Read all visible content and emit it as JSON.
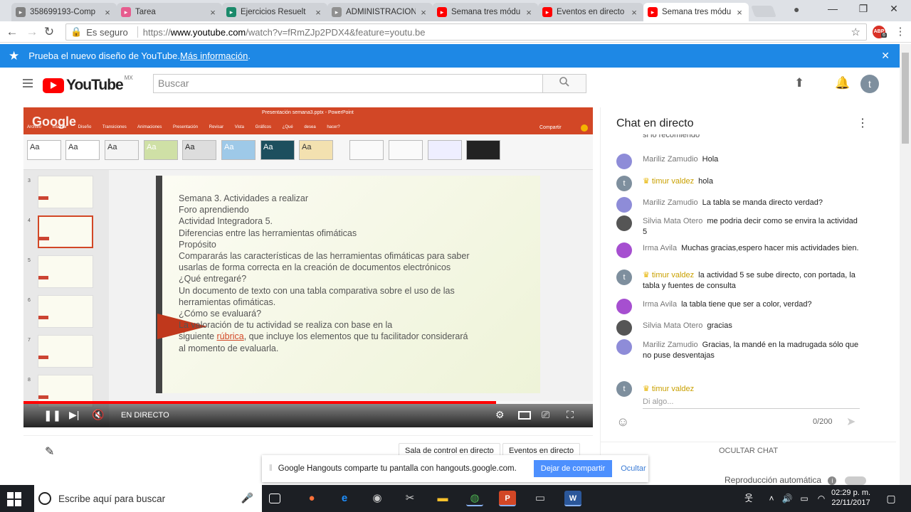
{
  "browser": {
    "tabs": [
      {
        "label": "358699193-Comp",
        "color": "#808080",
        "active": false
      },
      {
        "label": "Tarea",
        "color": "#e65c8e",
        "active": false
      },
      {
        "label": "Ejercicios Resuelt",
        "color": "#1b8a6b",
        "active": false
      },
      {
        "label": "ADMINISTRACIÓN",
        "color": "#909090",
        "active": false
      },
      {
        "label": "Semana tres módu",
        "color": "#ff0000",
        "active": false
      },
      {
        "label": "Eventos en directo",
        "color": "#ff0000",
        "active": false
      },
      {
        "label": "Semana tres módu",
        "color": "#ff0000",
        "active": true
      }
    ],
    "tab_close": "×",
    "secure_label": "Es seguro",
    "url_scheme": "https://",
    "url_host": "www.youtube.com",
    "url_path": "/watch?v=fRmZJp2PDX4&feature=youtu.be",
    "extension_badge": "6"
  },
  "banner": {
    "text": "Prueba el nuevo diseño de YouTube. ",
    "link": "Más información",
    "suffix": "."
  },
  "youtube": {
    "logo_word": "YouTube",
    "region": "MX",
    "search_placeholder": "Buscar",
    "avatar_letter": "t"
  },
  "slide": {
    "ppt_title": "Presentación semana3.pptx - PowerPoint",
    "ppt_tabs": "Archivo Insertar Diseño Transiciones Animaciones Presentación Revisar Vista Gráficos ¿Qué desea hacer?",
    "ppt_share": "Compartir",
    "watermark": "Google",
    "lines": [
      "Semana 3. Actividades a realizar",
      "Foro aprendiendo",
      "Actividad Integradora 5.",
      "Diferencias entre las herramientas ofimáticas",
      "Propósito",
      "Compararás las características de las herramientas ofimáticas para saber",
      "usarlas de forma correcta en la creación de documentos electrónicos",
      "¿Qué entregaré?",
      "Un documento de texto con una tabla comparativa sobre el uso de las",
      "herramientas ofimáticas.",
      "¿Cómo se evaluará?",
      "La valoración de tu actividad se realiza con base en la"
    ],
    "line_rubric_pre": "siguiente ",
    "line_rubric_link": "rúbrica",
    "line_rubric_post": ", que incluye los elementos que tu facilitador considerará",
    "last_line": "al momento de evaluarla.",
    "slide_numbers": [
      "3",
      "4",
      "5",
      "6",
      "7",
      "8"
    ],
    "theme_label": "Aa"
  },
  "player": {
    "progress": 0.83,
    "live_label": "EN DIRECTO"
  },
  "actions": {
    "control_room": "Sala de control en directo",
    "live_events": "Eventos en directo"
  },
  "chat": {
    "title": "Chat en directo",
    "partial_message": "si lo recomiendo",
    "messages": [
      {
        "author": "Mariliz Zamudio",
        "text": "Hola",
        "owner": false,
        "color": "#8e8cd8"
      },
      {
        "author": "timur valdez",
        "text": "hola",
        "owner": true,
        "color": "#7e8f9e"
      },
      {
        "author": "Mariliz Zamudio",
        "text": "La tabla se manda directo verdad?",
        "owner": false,
        "color": "#8e8cd8"
      },
      {
        "author": "Silvia Mata Otero",
        "text": "me podria decir como se envira la actividad 5",
        "owner": false,
        "color": "#555555"
      },
      {
        "author": "Irma Avila",
        "text": "Muchas gracias,espero hacer mis actividades bien.",
        "owner": false,
        "color": "#a64fd0"
      },
      {
        "author": "timur valdez",
        "text": "la actividad 5 se sube directo, con portada, la tabla y fuentes de consulta",
        "owner": true,
        "color": "#7e8f9e"
      },
      {
        "author": "Irma Avila",
        "text": "la tabla tiene que ser a color, verdad?",
        "owner": false,
        "color": "#a64fd0"
      },
      {
        "author": "Silvia Mata Otero",
        "text": "gracias",
        "owner": false,
        "color": "#555555"
      },
      {
        "author": "Mariliz Zamudio",
        "text": "Gracias, la mandé en la madrugada sólo que no puse desventajas",
        "owner": false,
        "color": "#8e8cd8"
      }
    ],
    "input_author": "timur valdez",
    "input_placeholder": "Di algo...",
    "char_count": "0/200",
    "hide_chat": "OCULTAR CHAT"
  },
  "hangouts": {
    "message": "Google Hangouts comparte tu pantalla con hangouts.google.com.",
    "stop": "Dejar de compartir",
    "hide": "Ocultar"
  },
  "autoplay": {
    "label": "Reproducción automática"
  },
  "taskbar": {
    "search_placeholder": "Escribe aquí para buscar",
    "time": "02:29 p. m.",
    "date": "22/11/2017"
  }
}
